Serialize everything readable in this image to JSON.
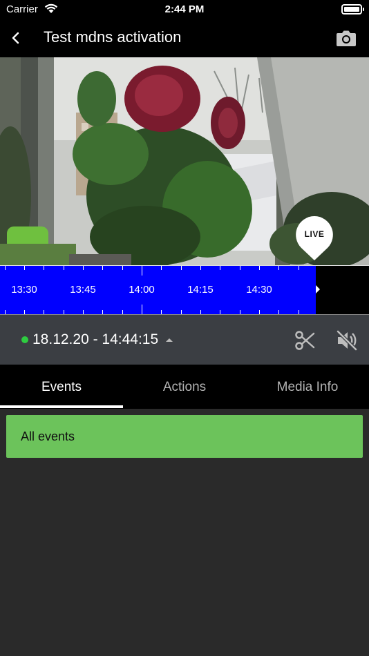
{
  "status_bar": {
    "carrier": "Carrier",
    "time": "2:44 PM",
    "battery_level": 1.0
  },
  "nav": {
    "title": "Test mdns activation",
    "back_icon": "chevron-left-icon",
    "camera_icon": "camera-icon"
  },
  "video": {
    "live_badge": "LIVE"
  },
  "timeline": {
    "labels": [
      "13:30",
      "13:45",
      "14:00",
      "14:15",
      "14:30"
    ],
    "recorded_fraction": 0.855,
    "fill_color": "#0000ff"
  },
  "controls": {
    "recording_indicator_color": "#2ecc40",
    "datetime": "18.12.20 - 14:44:15",
    "scissors_icon": "scissors-icon",
    "mute_icon": "speaker-muted-icon"
  },
  "tabs": [
    {
      "label": "Events",
      "active": true
    },
    {
      "label": "Actions",
      "active": false
    },
    {
      "label": "Media Info",
      "active": false
    }
  ],
  "events": {
    "items": [
      {
        "label": "All events",
        "color": "#6cc35b"
      }
    ]
  }
}
